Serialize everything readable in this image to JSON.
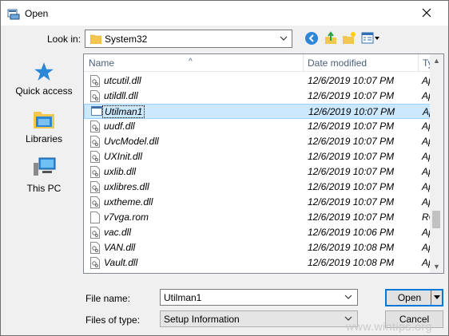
{
  "window": {
    "title": "Open"
  },
  "toolbar": {
    "look_in_label": "Look in:",
    "look_in_value": "System32"
  },
  "places": [
    {
      "label": "Quick access",
      "icon": "star-icon"
    },
    {
      "label": "Libraries",
      "icon": "libraries-icon"
    },
    {
      "label": "This PC",
      "icon": "computer-icon"
    }
  ],
  "columns": {
    "name": "Name",
    "date": "Date modified",
    "type": "Ty"
  },
  "files": [
    {
      "name": "utcutil.dll",
      "date": "12/6/2019 10:07 PM",
      "type": "Ap",
      "icon": "dll"
    },
    {
      "name": "utildll.dll",
      "date": "12/6/2019 10:07 PM",
      "type": "Ap",
      "icon": "dll"
    },
    {
      "name": "Utilman1",
      "date": "12/6/2019 10:07 PM",
      "type": "Ap",
      "icon": "exe",
      "selected": true
    },
    {
      "name": "uudf.dll",
      "date": "12/6/2019 10:07 PM",
      "type": "Ap",
      "icon": "dll"
    },
    {
      "name": "UvcModel.dll",
      "date": "12/6/2019 10:07 PM",
      "type": "Ap",
      "icon": "dll"
    },
    {
      "name": "UXInit.dll",
      "date": "12/6/2019 10:07 PM",
      "type": "Ap",
      "icon": "dll"
    },
    {
      "name": "uxlib.dll",
      "date": "12/6/2019 10:07 PM",
      "type": "Ap",
      "icon": "dll"
    },
    {
      "name": "uxlibres.dll",
      "date": "12/6/2019 10:07 PM",
      "type": "Ap",
      "icon": "dll"
    },
    {
      "name": "uxtheme.dll",
      "date": "12/6/2019 10:07 PM",
      "type": "Ap",
      "icon": "dll"
    },
    {
      "name": "v7vga.rom",
      "date": "12/6/2019 10:07 PM",
      "type": "RC",
      "icon": "file"
    },
    {
      "name": "vac.dll",
      "date": "12/6/2019 10:06 PM",
      "type": "Ap",
      "icon": "dll"
    },
    {
      "name": "VAN.dll",
      "date": "12/6/2019 10:08 PM",
      "type": "Ap",
      "icon": "dll"
    },
    {
      "name": "Vault.dll",
      "date": "12/6/2019 10:08 PM",
      "type": "Ap",
      "icon": "dll"
    }
  ],
  "form": {
    "file_name_label": "File name:",
    "file_name_value": "Utilman1",
    "files_of_type_label": "Files of type:",
    "files_of_type_value": "Setup Information"
  },
  "buttons": {
    "open": "Open",
    "cancel": "Cancel"
  },
  "watermark": "www.wintips.org",
  "colors": {
    "accent": "#0078d7",
    "selection": "#cce8ff"
  }
}
